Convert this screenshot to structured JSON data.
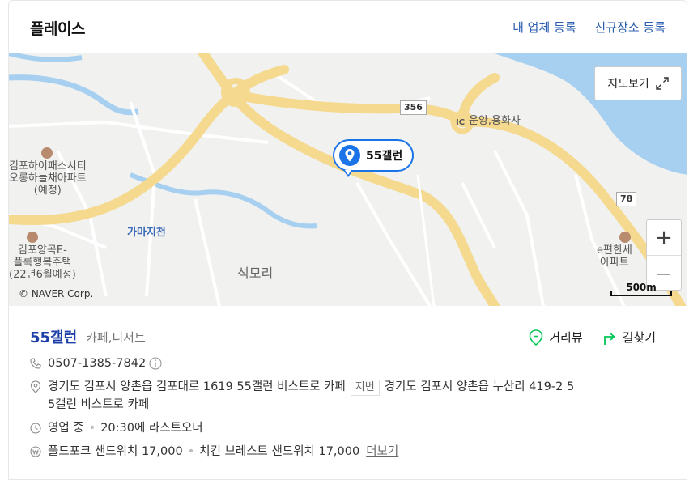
{
  "header": {
    "title": "플레이스",
    "link_my_business": "내 업체 등록",
    "link_new_place": "신규장소 등록"
  },
  "map": {
    "labels": {
      "gimpo_hi_pass": "김포하이패스시티\n오롱하늘채아파트\n(예정)",
      "gamaji": "가마지천",
      "gimpo_yanggok": "김포양곡E-\n플룩행복주택\n(22년6월예정)",
      "seokmori": "석모리",
      "unyang": "운양,용화사",
      "e_pyeonhan": "e편한세\n아파트",
      "road_356": "356",
      "road_78": "78",
      "ic": "IC"
    },
    "marker_label": "55갤런",
    "view_button": "지도보기",
    "zoom_in": "+",
    "zoom_out": "—",
    "copyright": "© NAVER Corp.",
    "scale": "500m"
  },
  "place": {
    "name": "55갤런",
    "category": "카페,디저트",
    "action_street_view": "거리뷰",
    "action_directions": "길찾기",
    "phone": "0507-1385-7842",
    "address": "경기도 김포시 양촌읍 김포대로 1619 55갤런 비스트로 카페",
    "jibun_tag": "지번",
    "jibun_address_line1": "경기도 김포시 양촌읍 누산리 419-2 5",
    "jibun_address_line2": "5갤런 비스트로 카페",
    "hours_status": "영업 중",
    "hours_note": "20:30에 라스트오더",
    "menu_item1": "풀드포크 샌드위치 17,000",
    "menu_item2": "치킨 브레스트 샌드위치 17,000",
    "more_label": "더보기"
  },
  "colors": {
    "accent": "#1b73e8",
    "name_blue": "#1c3fa8",
    "green": "#03c75a",
    "road_yellow": "#f7dfa0",
    "water": "#a6cff0"
  }
}
